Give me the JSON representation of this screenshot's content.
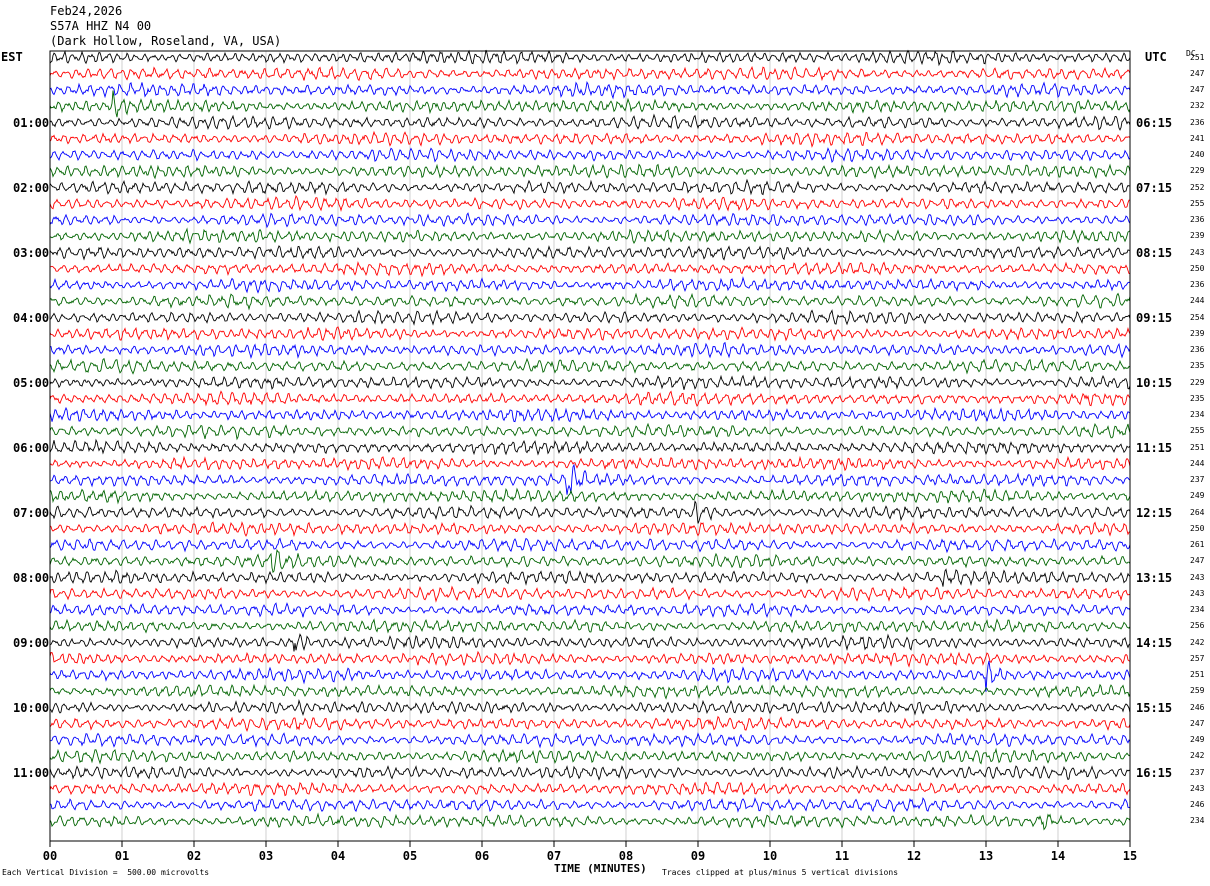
{
  "header": {
    "date": "Feb24,2026",
    "channel": "S57A HHZ N4 00",
    "location": "(Dark Hollow, Roseland, VA, USA)"
  },
  "left_tz": "EST",
  "right_tz": "UTC",
  "dc_label": "DC",
  "footer": {
    "left": "Each Vertical Division =  500.00 microvolts",
    "right": "Traces clipped at plus/minus 5 vertical divisions"
  },
  "colors": {
    "black": "#000000",
    "red": "#ff0000",
    "blue": "#0000ff",
    "green": "#006400",
    "grid": "#b0b0b0"
  },
  "chart_data": {
    "type": "line",
    "title": "S57A HHZ N4 00",
    "xlabel": "TIME (MINUTES)",
    "xlim": [
      0,
      15
    ],
    "x_ticks": [
      "00",
      "01",
      "02",
      "03",
      "04",
      "05",
      "06",
      "07",
      "08",
      "09",
      "10",
      "11",
      "12",
      "13",
      "14",
      "15"
    ],
    "trace_interval_minutes": 15,
    "trace_count": 48,
    "color_cycle": [
      "black",
      "red",
      "blue",
      "green"
    ],
    "left_hour_labels": [
      "01:00",
      "02:00",
      "03:00",
      "04:00",
      "05:00",
      "06:00",
      "07:00",
      "08:00",
      "09:00",
      "10:00",
      "11:00"
    ],
    "right_hour_labels": [
      "06:15",
      "07:15",
      "08:15",
      "09:15",
      "10:15",
      "11:15",
      "12:15",
      "13:15",
      "14:15",
      "15:15",
      "16:15"
    ],
    "dc_offsets": [
      251,
      247,
      247,
      232,
      236,
      241,
      240,
      229,
      252,
      255,
      236,
      239,
      243,
      250,
      236,
      244,
      254,
      239,
      236,
      235,
      229,
      235,
      234,
      255,
      251,
      244,
      237,
      249,
      264,
      250,
      261,
      247,
      243,
      243,
      234,
      256,
      242,
      257,
      251,
      259,
      246,
      247,
      249,
      242,
      237,
      243,
      246,
      234
    ],
    "events": [
      {
        "trace": 3,
        "minute": 0.85,
        "amp": 0.9
      },
      {
        "trace": 26,
        "minute": 7.15,
        "amp": 2.2
      },
      {
        "trace": 28,
        "minute": 8.95,
        "amp": 0.8
      },
      {
        "trace": 31,
        "minute": 3.05,
        "amp": 0.8
      },
      {
        "trace": 32,
        "minute": 12.4,
        "amp": 0.8
      },
      {
        "trace": 36,
        "minute": 3.35,
        "amp": 1.2
      },
      {
        "trace": 38,
        "minute": 13.0,
        "amp": 0.9
      },
      {
        "trace": 47,
        "minute": 13.75,
        "amp": 0.7
      }
    ]
  }
}
